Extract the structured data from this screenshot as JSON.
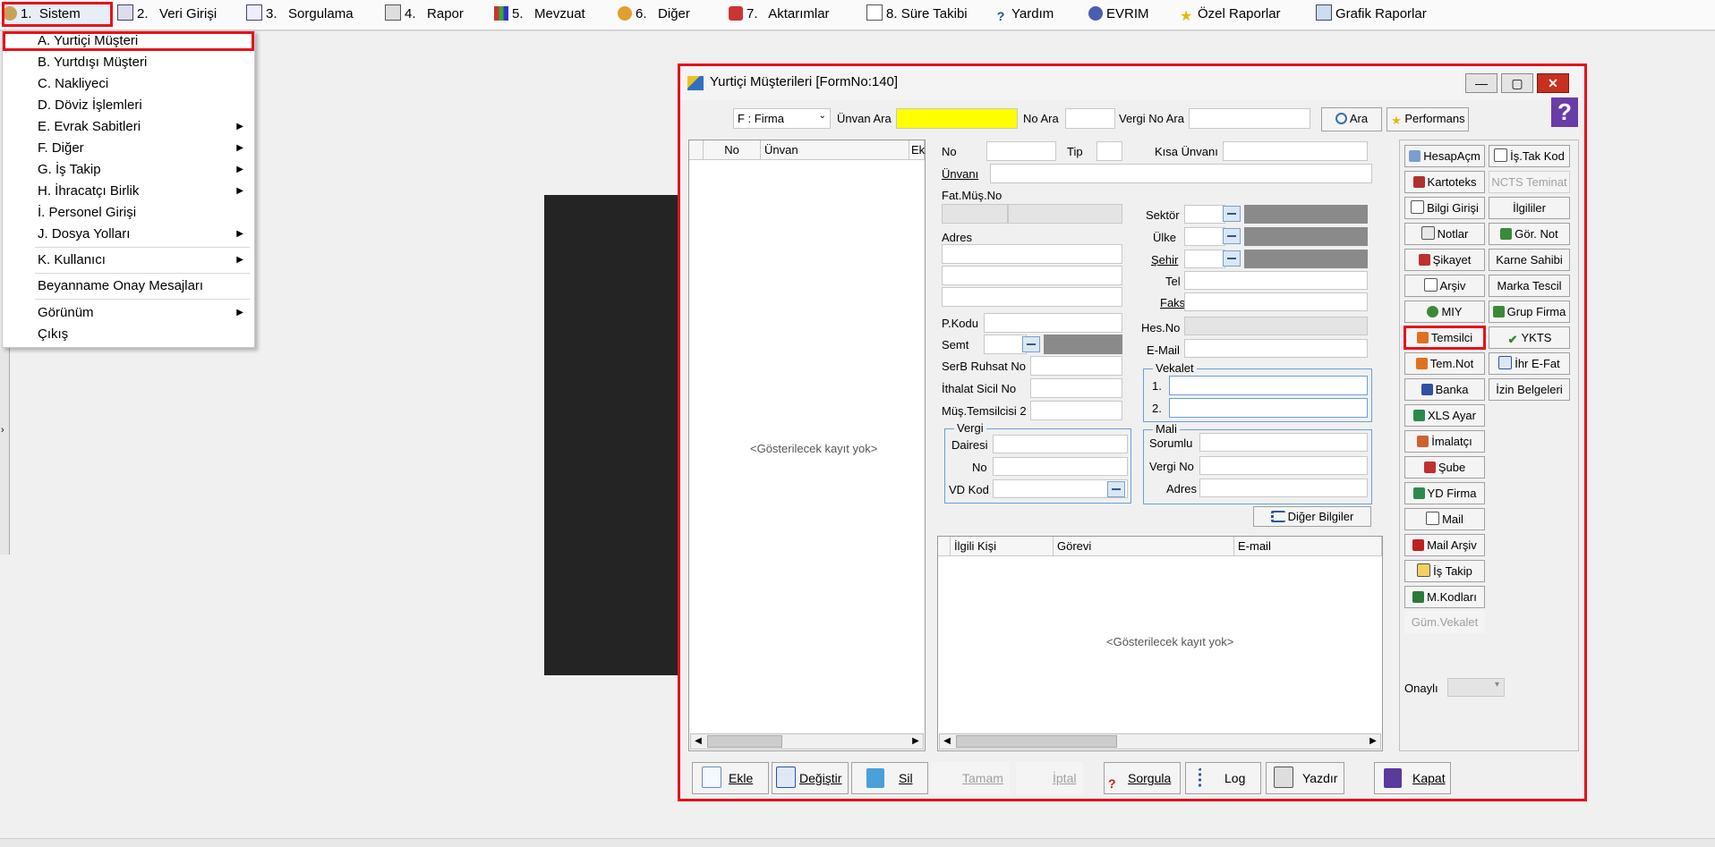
{
  "menubar": {
    "items": [
      {
        "num": "1.",
        "label": "Sistem"
      },
      {
        "num": "2.",
        "label": "Veri Girişi"
      },
      {
        "num": "3.",
        "label": "Sorgulama"
      },
      {
        "num": "4.",
        "label": "Rapor"
      },
      {
        "num": "5.",
        "label": "Mevzuat"
      },
      {
        "num": "6.",
        "label": "Diğer"
      },
      {
        "num": "7.",
        "label": "Aktarımlar"
      },
      {
        "num": "8.",
        "label": "Süre Takibi"
      },
      {
        "num": "",
        "label": "Yardım"
      },
      {
        "num": "",
        "label": "EVRIM"
      },
      {
        "num": "",
        "label": "Özel Raporlar"
      },
      {
        "num": "",
        "label": "Grafik Raporlar"
      }
    ]
  },
  "dropdown": {
    "items": [
      {
        "label": "A.  Yurtiçi Müşteri",
        "submenu": false
      },
      {
        "label": "B.  Yurtdışı Müşteri",
        "submenu": false
      },
      {
        "label": "C.  Nakliyeci",
        "submenu": false
      },
      {
        "label": "D.  Döviz İşlemleri",
        "submenu": false
      },
      {
        "label": "E.  Evrak Sabitleri",
        "submenu": true
      },
      {
        "label": "F.  Diğer",
        "submenu": true
      },
      {
        "label": "G.  İş Takip",
        "submenu": true
      },
      {
        "label": "H.  İhracatçı Birlik",
        "submenu": true
      },
      {
        "label": "İ.  Personel Girişi",
        "submenu": false
      },
      {
        "label": "J.  Dosya Yolları",
        "submenu": true
      },
      {
        "label": "K.  Kullanıcı",
        "submenu": true
      },
      {
        "label": "Beyanname Onay Mesajları",
        "submenu": false
      },
      {
        "label": "Görünüm",
        "submenu": true
      },
      {
        "label": "Çıkış",
        "submenu": false
      }
    ]
  },
  "window": {
    "title": "Yurtiçi Müşterileri [FormNo:140]",
    "controls": {
      "minimize": "—",
      "maximize": "▢",
      "close": "✕"
    }
  },
  "search": {
    "type_select": "F : Firma",
    "unvan_ara_label": "Ünvan Ara",
    "unvan_ara_value": "",
    "no_ara_label": "No Ara",
    "vergi_no_ara_label": "Vergi No Ara",
    "ara_button": "Ara",
    "performans_button": "Performans"
  },
  "left_grid": {
    "columns": [
      "No",
      "Ünvan",
      "Ek"
    ],
    "empty_message": "<Gösterilecek kayıt yok>"
  },
  "form": {
    "no": "No",
    "tip": "Tip",
    "kisa_unvani": "Kısa Ünvanı",
    "unvani": "Ünvanı",
    "fat_mus_no": "Fat.Müş.No",
    "adres": "Adres",
    "pkodu": "P.Kodu",
    "semt": "Semt",
    "serb_ruhsat_no": "SerB Ruhsat No",
    "ithalat_sicil_no": "İthalat Sicil No",
    "mus_temsilcisi2": "Müş.Temsilcisi 2",
    "sektor": "Sektör",
    "ulke": "Ülke",
    "sehir": "Şehir",
    "tel": "Tel",
    "faks": "Faks",
    "hes_no": "Hes.No",
    "email": "E-Mail",
    "vekalet": {
      "title": "Vekalet",
      "row1": "1.",
      "row2": "2."
    },
    "vergi": {
      "title": "Vergi",
      "dairesi": "Dairesi",
      "no": "No",
      "vd_kod": "VD Kod"
    },
    "mali": {
      "title": "Mali",
      "sorumlu": "Sorumlu",
      "vergi_no": "Vergi No",
      "adres": "Adres"
    },
    "diger_bilgiler_button": "Diğer Bilgiler"
  },
  "contact_grid": {
    "columns": [
      "İlgili Kişi",
      "Görevi",
      "E-mail"
    ],
    "empty_message": "<Gösterilecek kayıt yok>"
  },
  "right_buttons": {
    "col1": [
      "HesapAçm",
      "Kartoteks",
      "Bilgi Girişi",
      "Notlar",
      "Şikayet",
      "Arşiv",
      "MIY",
      "Temsilci",
      "Tem.Not",
      "Banka",
      "XLS Ayar",
      "İmalatçı",
      "Şube",
      "YD Firma",
      "Mail",
      "Mail Arşiv",
      "İş Takip",
      "M.Kodları",
      "Güm.Vekalet"
    ],
    "col2": [
      "İş.Tak Kod",
      "NCTS Teminat",
      "İlgililer",
      "Gör. Not",
      "Karne Sahibi",
      "Marka Tescil",
      "Grup Firma",
      "YKTS",
      "İhr E-Fat",
      "İzin Belgeleri"
    ],
    "onayli_label": "Onaylı"
  },
  "bottom_buttons": [
    "Ekle",
    "Değiştir",
    "Sil",
    "Tamam",
    "İptal",
    "Sorgula",
    "Log",
    "Yazdır",
    "Kapat"
  ],
  "colors": {
    "highlight": "#e8101a",
    "search_field": "#ffff00",
    "dark_panel": "#242424"
  }
}
